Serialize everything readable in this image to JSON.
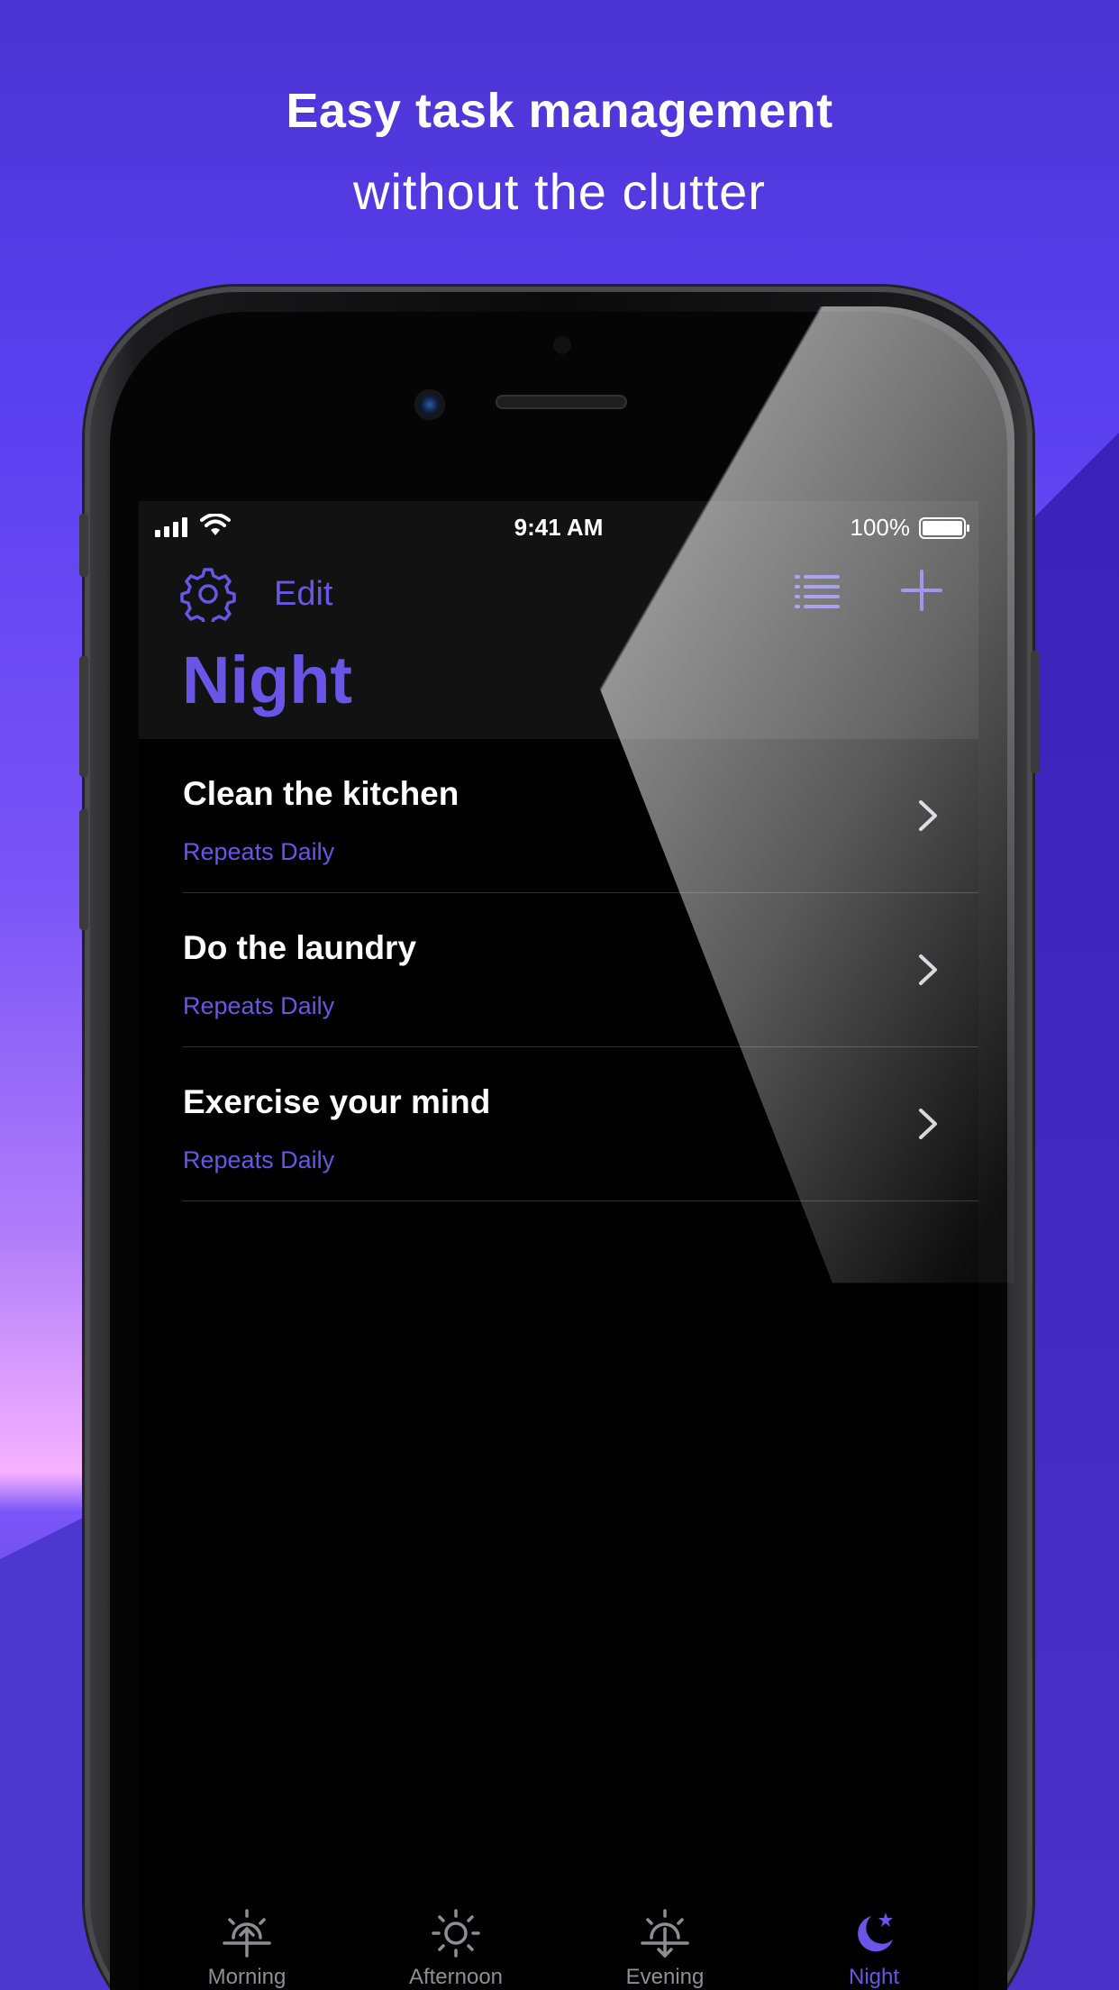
{
  "marketing": {
    "headline": "Easy task management",
    "subline": "without the clutter"
  },
  "status_bar": {
    "time": "9:41 AM",
    "battery": "100%"
  },
  "toolbar": {
    "settings_icon": "gear-icon",
    "edit_label": "Edit",
    "list_icon": "list-icon",
    "add_icon": "plus-icon"
  },
  "page_title": "Night",
  "tasks": [
    {
      "title": "Clean the kitchen",
      "repeat": "Repeats Daily"
    },
    {
      "title": "Do the laundry",
      "repeat": "Repeats Daily"
    },
    {
      "title": "Exercise your mind",
      "repeat": "Repeats Daily"
    }
  ],
  "tabs": [
    {
      "label": "Morning",
      "icon": "sunrise-icon",
      "active": false
    },
    {
      "label": "Afternoon",
      "icon": "sun-icon",
      "active": false
    },
    {
      "label": "Evening",
      "icon": "sunset-icon",
      "active": false
    },
    {
      "label": "Night",
      "icon": "moon-star-icon",
      "active": true
    }
  ],
  "colors": {
    "accent": "#6a55e6",
    "inactive_tab": "#8e8e93",
    "background": "#000000"
  }
}
